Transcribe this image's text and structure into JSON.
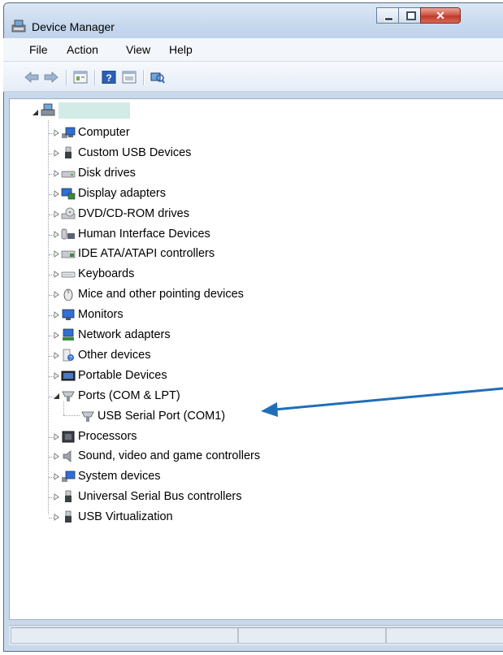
{
  "window": {
    "title": "Device Manager"
  },
  "menu": {
    "file": "File",
    "action": "Action",
    "view": "View",
    "help": "Help"
  },
  "toolbar": {
    "buttons": [
      "back-icon",
      "forward-icon",
      "properties-icon",
      "help-icon",
      "show-hidden-icon",
      "scan-hardware-icon"
    ]
  },
  "tree": {
    "root_label": "",
    "items": [
      {
        "label": "Computer",
        "icon": "computer-icon"
      },
      {
        "label": "Custom USB Devices",
        "icon": "usb-plug-icon"
      },
      {
        "label": "Disk drives",
        "icon": "disk-drive-icon"
      },
      {
        "label": "Display adapters",
        "icon": "display-adapter-icon"
      },
      {
        "label": "DVD/CD-ROM drives",
        "icon": "dvd-drive-icon"
      },
      {
        "label": "Human Interface Devices",
        "icon": "hid-icon"
      },
      {
        "label": "IDE ATA/ATAPI controllers",
        "icon": "ide-controller-icon"
      },
      {
        "label": "Keyboards",
        "icon": "keyboard-icon"
      },
      {
        "label": "Mice and other pointing devices",
        "icon": "mouse-icon"
      },
      {
        "label": "Monitors",
        "icon": "monitor-icon"
      },
      {
        "label": "Network adapters",
        "icon": "network-adapter-icon"
      },
      {
        "label": "Other devices",
        "icon": "other-devices-icon"
      },
      {
        "label": "Portable Devices",
        "icon": "portable-device-icon"
      },
      {
        "label": "Ports (COM & LPT)",
        "icon": "port-icon",
        "expanded": true,
        "children": [
          {
            "label": "USB Serial Port (COM1)",
            "icon": "port-icon"
          }
        ]
      },
      {
        "label": "Processors",
        "icon": "processor-icon"
      },
      {
        "label": "Sound, video and game controllers",
        "icon": "speaker-icon"
      },
      {
        "label": "System devices",
        "icon": "system-devices-icon"
      },
      {
        "label": "Universal Serial Bus controllers",
        "icon": "usb-plug-icon"
      },
      {
        "label": "USB Virtualization",
        "icon": "usb-plug-icon"
      }
    ]
  },
  "colors": {
    "title_bar": "#c6d8ee",
    "close_button": "#c0392b",
    "annotation_arrow": "#1f6fb8"
  }
}
